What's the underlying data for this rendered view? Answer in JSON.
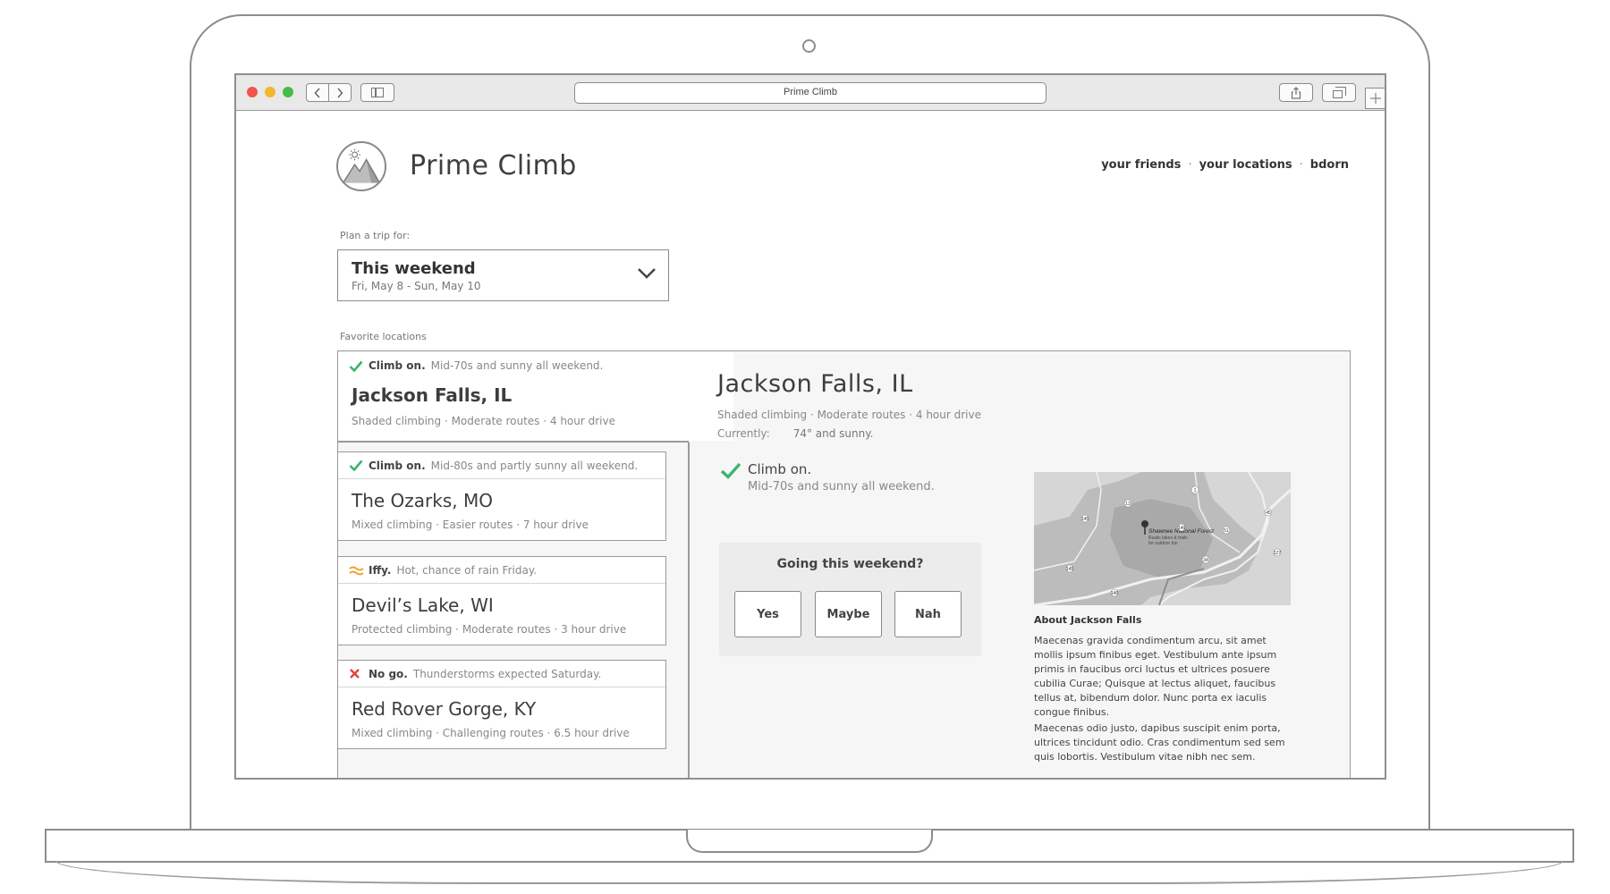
{
  "browser": {
    "url_title": "Prime Climb"
  },
  "app": {
    "brand": "Prime Climb"
  },
  "nav": {
    "links": [
      "your friends",
      "your locations",
      "bdorn"
    ],
    "separator": "·"
  },
  "trip": {
    "label": "Plan a trip for:",
    "selected_title": "This weekend",
    "selected_dates": "Fri, May 8 - Sun, May 10"
  },
  "favorites": {
    "label": "Favorite locations",
    "items": [
      {
        "status_icon": "check-icon",
        "status_label": "Climb on.",
        "status_text": "Mid-70s and sunny all weekend.",
        "name": "Jackson Falls, IL",
        "meta": "Shaded climbing  ·  Moderate routes  ·  4 hour drive"
      },
      {
        "status_icon": "check-icon",
        "status_label": "Climb on.",
        "status_text": "Mid-80s and partly sunny all weekend.",
        "name": "The Ozarks, MO",
        "meta": "Mixed climbing  ·  Easier routes  ·  7 hour drive"
      },
      {
        "status_icon": "wave-icon",
        "status_label": "Iffy.",
        "status_text": "Hot, chance of rain Friday.",
        "name": "Devil’s Lake, WI",
        "meta": "Protected climbing  ·  Moderate routes  ·  3 hour drive"
      },
      {
        "status_icon": "x-icon",
        "status_label": "No go.",
        "status_text": "Thunderstorms expected Saturday.",
        "name": "Red Rover Gorge, KY",
        "meta": "Mixed climbing  ·  Challenging routes  ·  6.5 hour drive"
      }
    ]
  },
  "detail": {
    "title": "Jackson Falls, IL",
    "meta": "Shaded climbing  ·  Moderate routes  ·  4 hour drive",
    "current_label": "Currently:",
    "current_value": "74° and sunny.",
    "status_label": "Climb on.",
    "status_desc": "Mid-70s and sunny all weekend.",
    "going_title": "Going this weekend?",
    "buttons": {
      "yes": "Yes",
      "maybe": "Maybe",
      "nah": "Nah"
    },
    "map": {
      "label": "Shawnee National Forest",
      "sub1": "Rustic lakes & trails",
      "sub2": "for outdoor fun",
      "route_numbers": [
        "1",
        "13",
        "145",
        "145",
        "146",
        "146",
        "51",
        "45",
        "127",
        "34"
      ]
    },
    "about_title": "About Jackson Falls",
    "about_p1": "Maecenas gravida condimentum arcu, sit amet mollis ipsum finibus eget. Vestibulum ante ipsum primis in faucibus orci luctus et ultrices posuere cubilia Curae; Quisque at lectus aliquet, faucibus tellus at, bibendum dolor. Nunc porta ex iaculis congue finibus.",
    "about_p2": "Maecenas odio justo, dapibus suscipit enim porta, ultrices tincidunt odio. Cras condimentum sed sem quis lobortis. Vestibulum vitae nibh nec sem."
  },
  "colors": {
    "check": "#3cb46e",
    "iffy": "#f0a030",
    "nogo": "#e0443c",
    "outline": "#8c8c8c"
  }
}
